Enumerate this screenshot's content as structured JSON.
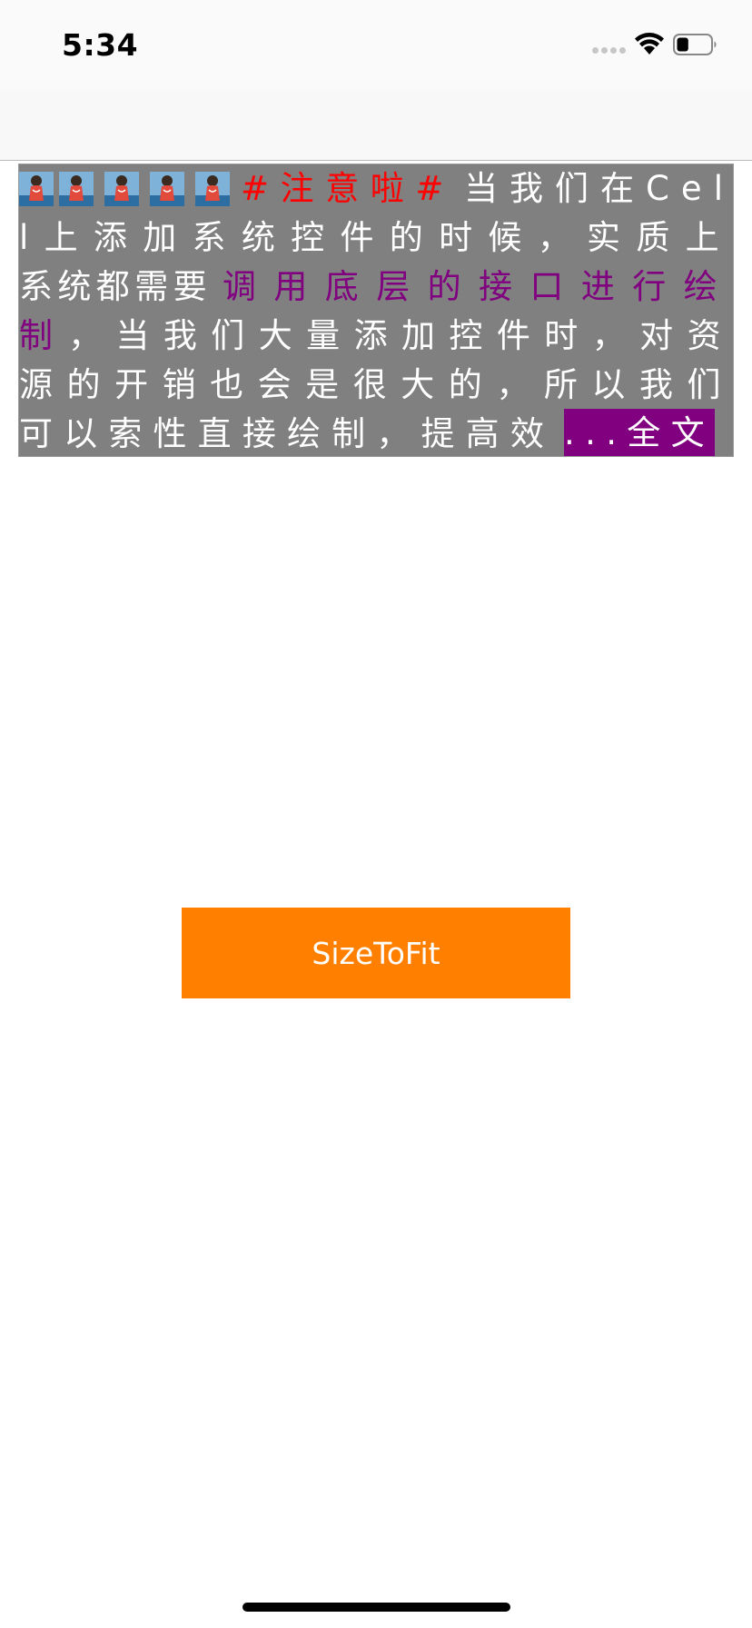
{
  "status_bar": {
    "time": "5:34",
    "signal_icon": "cellular-signal-icon",
    "wifi_icon": "wifi-icon",
    "battery_icon": "battery-icon",
    "battery_level": 0.35
  },
  "nav_bar": {
    "title": ""
  },
  "text_card": {
    "emoji_count": 5,
    "emoji_icon": "woman-avatar-emoji-icon",
    "hashtag": "#注意啦#",
    "body_part1": "当我们在Cell上添加系统控件的时候，实质上系统都需要",
    "link_text": "调用底层的接口进行绘制",
    "body_part2": "，当我们大量添加控件时，对资源的开销也会是很大的，所以我们可以索性直接绘制，提高效",
    "more_label": "...全文",
    "lines": [
      "#注意啦#当我们在Cell",
      "上添加系统控件的时候，实质上系",
      "统都需要调用底层的接口进行绘",
      "制，当我们大量添加控件时，对资",
      "源的开销也会是很大的，所以我们",
      "可以索性直接绘制，提高效"
    ],
    "colors": {
      "background": "#808080",
      "text": "#ffffff",
      "hashtag": "#ff0000",
      "link": "#800080",
      "more_background": "#800080"
    }
  },
  "size_to_fit_button": {
    "label": "SizeToFit",
    "color": "#ff8000"
  }
}
